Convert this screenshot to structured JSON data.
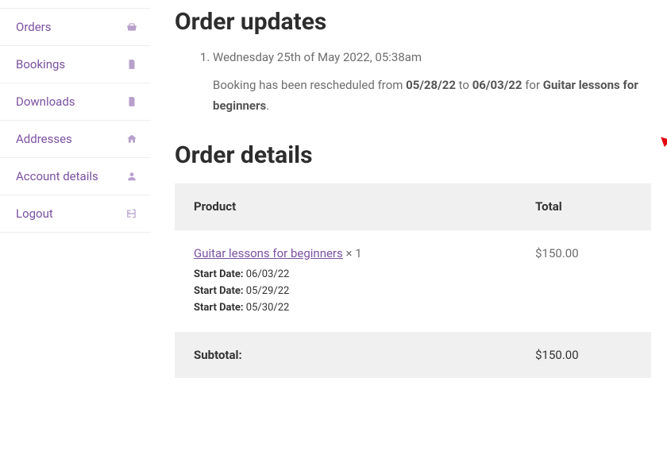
{
  "sidebar": {
    "items": [
      {
        "label": "Orders",
        "icon": "basket-icon"
      },
      {
        "label": "Bookings",
        "icon": "file-icon"
      },
      {
        "label": "Downloads",
        "icon": "download-file-icon"
      },
      {
        "label": "Addresses",
        "icon": "home-icon"
      },
      {
        "label": "Account details",
        "icon": "user-icon"
      },
      {
        "label": "Logout",
        "icon": "logout-icon"
      }
    ]
  },
  "updates": {
    "heading": "Order updates",
    "items": [
      {
        "date": "Wednesday 25th of May 2022, 05:38am",
        "body_prefix": "Booking has been rescheduled from ",
        "from_date": "05/28/22",
        "mid": " to ",
        "to_date": "06/03/22",
        "for_text": " for ",
        "product": "Guitar lessons for beginners",
        "period": "."
      }
    ]
  },
  "details": {
    "heading": "Order details",
    "col_product": "Product",
    "col_total": "Total",
    "rows": [
      {
        "link": "Guitar lessons for beginners",
        "qty": " × 1",
        "dates": [
          {
            "label": "Start Date:",
            "value": " 06/03/22"
          },
          {
            "label": "Start Date:",
            "value": " 05/29/22"
          },
          {
            "label": "Start Date:",
            "value": " 05/30/22"
          }
        ],
        "total": "$150.00"
      }
    ],
    "subtotal_label": "Subtotal:",
    "subtotal_value": "$150.00"
  },
  "colors": {
    "accent": "#7c51a1",
    "arrow": "#e3000f"
  }
}
